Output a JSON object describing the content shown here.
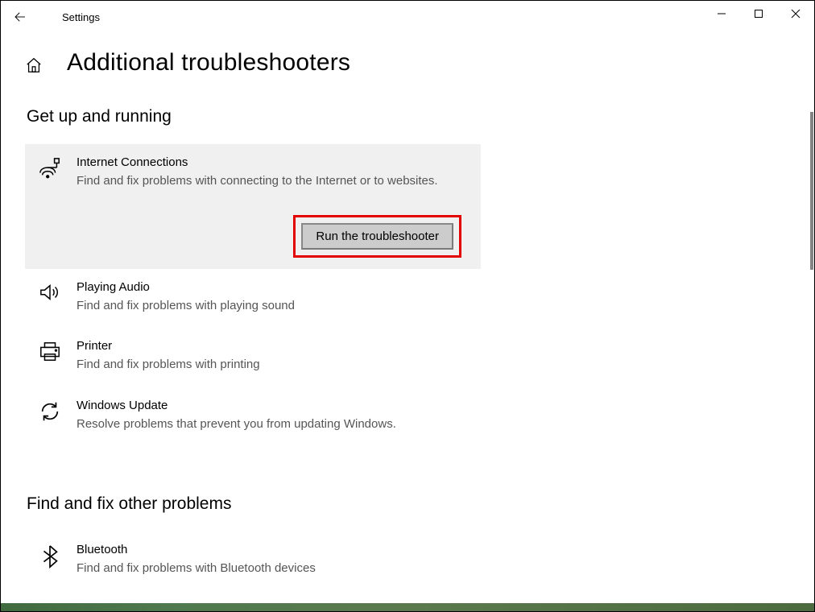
{
  "titlebar": {
    "title": "Settings"
  },
  "page_title": "Additional troubleshooters",
  "section1": {
    "heading": "Get up and running",
    "items": [
      {
        "name": "Internet Connections",
        "desc": "Find and fix problems with connecting to the Internet or to websites.",
        "run_label": "Run the troubleshooter"
      },
      {
        "name": "Playing Audio",
        "desc": "Find and fix problems with playing sound"
      },
      {
        "name": "Printer",
        "desc": "Find and fix problems with printing"
      },
      {
        "name": "Windows Update",
        "desc": "Resolve problems that prevent you from updating Windows."
      }
    ]
  },
  "section2": {
    "heading": "Find and fix other problems",
    "items": [
      {
        "name": "Bluetooth",
        "desc": "Find and fix problems with Bluetooth devices"
      }
    ]
  }
}
